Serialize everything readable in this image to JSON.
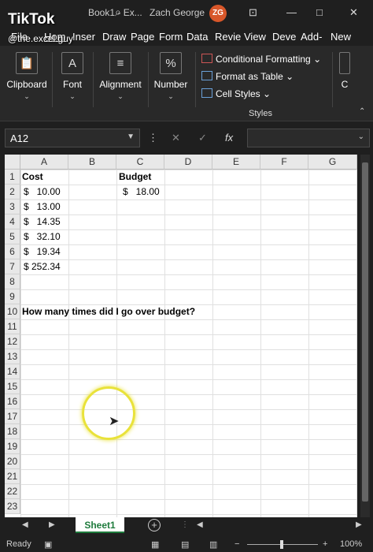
{
  "titlebar": {
    "doc_name": "Book1 - Ex...",
    "user": "Zach George",
    "avatar_initials": "ZG",
    "minimize": "—",
    "restore": "□",
    "close": "✕"
  },
  "overlay": {
    "brand": "TikTok",
    "user": "@the.excel.guy"
  },
  "tabs": [
    "File",
    "Hom",
    "Inser",
    "Draw",
    "Page",
    "Form",
    "Data",
    "Revie",
    "View",
    "Deve",
    "Add-",
    "New"
  ],
  "ribbon": {
    "clipboard": "Clipboard",
    "font": "Font",
    "alignment": "Alignment",
    "number": "Number",
    "conditional_formatting": "Conditional Formatting",
    "format_as_table": "Format as Table",
    "cell_styles": "Cell Styles",
    "styles_group": "Styles",
    "cells": "C"
  },
  "formula_bar": {
    "name_box": "A12",
    "formula": ""
  },
  "columns": [
    "A",
    "B",
    "C",
    "D",
    "E",
    "F",
    "G"
  ],
  "rows": [
    "1",
    "2",
    "3",
    "4",
    "5",
    "6",
    "7",
    "8",
    "9",
    "10",
    "11",
    "12",
    "13",
    "14",
    "15",
    "16",
    "17",
    "18",
    "19",
    "20",
    "21",
    "22",
    "23"
  ],
  "cells": {
    "A1": "Cost",
    "C1": "Budget",
    "A2": "$   10.00",
    "C2": "$   18.00",
    "A3": "$   13.00",
    "A4": "$   14.35",
    "A5": "$   32.10",
    "A6": "$   19.34",
    "A7": "$ 252.34",
    "A10": "How many times did I go over budget?"
  },
  "sheet_tabs": {
    "active": "Sheet1",
    "add": "+"
  },
  "status": {
    "ready": "Ready",
    "zoom": "100%",
    "zoom_out": "−",
    "zoom_in": "+"
  }
}
